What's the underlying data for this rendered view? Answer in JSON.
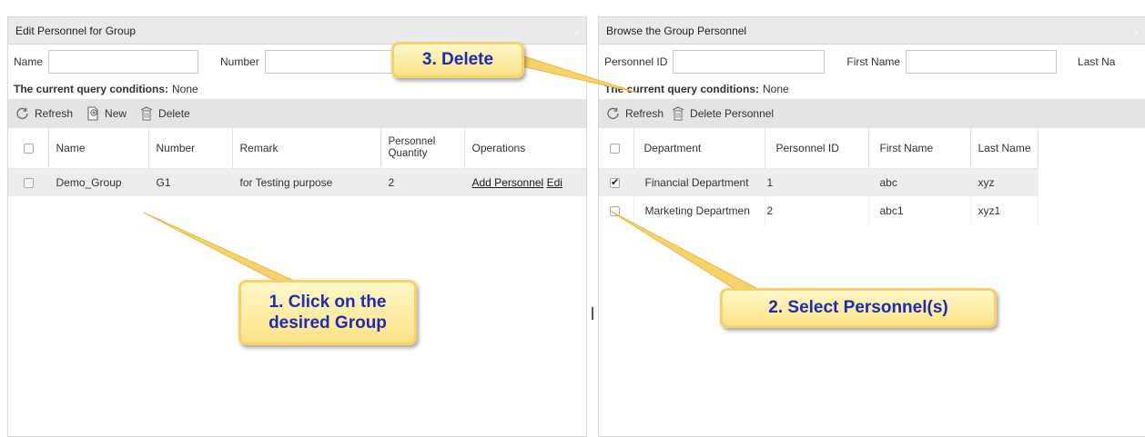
{
  "left_panel": {
    "title": "Edit Personnel for Group",
    "query": {
      "name_label": "Name",
      "name_value": "",
      "number_label": "Number",
      "number_value": ""
    },
    "conditions_label": "The current query conditions:",
    "conditions_value": "None",
    "toolbar": {
      "refresh": "Refresh",
      "new": "New",
      "delete": "Delete"
    },
    "columns": [
      "Name",
      "Number",
      "Remark",
      "Personnel Quantity",
      "Operations"
    ],
    "rows": [
      {
        "checked": false,
        "name": "Demo_Group",
        "number": "G1",
        "remark": "for Testing purpose",
        "quantity": "2",
        "op_add": "Add Personnel",
        "op_edit": "Edi"
      }
    ]
  },
  "right_panel": {
    "title": "Browse the Group Personnel",
    "query": {
      "personnel_id_label": "Personnel ID",
      "personnel_id_value": "",
      "first_name_label": "First Name",
      "first_name_value": "",
      "last_name_label": "Last Na"
    },
    "conditions_label": "The current query conditions:",
    "conditions_value": "None",
    "toolbar": {
      "refresh": "Refresh",
      "delete_personnel": "Delete Personnel"
    },
    "columns": [
      "Department",
      "Personnel ID",
      "First Name",
      "Last Name"
    ],
    "rows": [
      {
        "checked": true,
        "department": "Financial Department",
        "personnel_id": "1",
        "first_name": "abc",
        "last_name": "xyz"
      },
      {
        "checked": false,
        "department": "Marketing Departmen",
        "personnel_id": "2",
        "first_name": "abc1",
        "last_name": "xyz1"
      }
    ]
  },
  "callouts": {
    "step1": "1. Click on the desired Group",
    "step2": "2. Select Personnel(s)",
    "step3": "3. Delete"
  },
  "colors": {
    "callout_text": "#1d2bb8",
    "callout_fill": "#fbe385",
    "header_bg": "#eaeaea",
    "toolbar_bg": "#e4e4e4",
    "selected_row_bg": "#ededed"
  }
}
